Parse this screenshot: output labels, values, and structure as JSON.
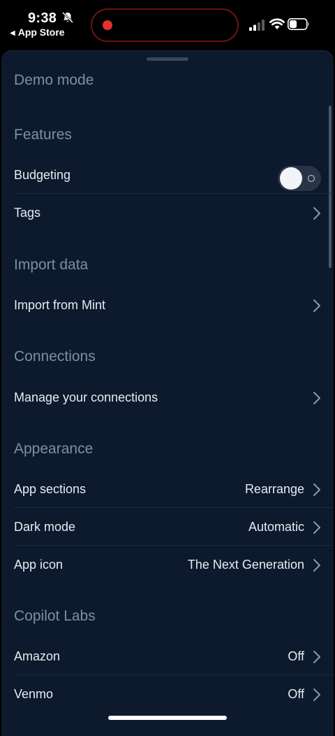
{
  "status_bar": {
    "time": "9:38",
    "back_label": "App Store",
    "icons": [
      "bell-off-icon",
      "recording-icon",
      "signal-icon",
      "wifi-icon",
      "battery-icon"
    ]
  },
  "colors": {
    "background": "#0d1a2d",
    "section_title": "#7e8ea6",
    "text": "#e6ebf2",
    "recording": "#e5322d"
  },
  "sections": {
    "demo_mode": {
      "title": "Demo mode"
    },
    "features": {
      "title": "Features",
      "budgeting": {
        "label": "Budgeting",
        "toggle_on": false
      },
      "tags": {
        "label": "Tags"
      }
    },
    "import_data": {
      "title": "Import data",
      "import_mint": {
        "label": "Import from Mint"
      }
    },
    "connections": {
      "title": "Connections",
      "manage": {
        "label": "Manage your connections"
      }
    },
    "appearance": {
      "title": "Appearance",
      "app_sections": {
        "label": "App sections",
        "value": "Rearrange"
      },
      "dark_mode": {
        "label": "Dark mode",
        "value": "Automatic"
      },
      "app_icon": {
        "label": "App icon",
        "value": "The Next Generation"
      }
    },
    "copilot_labs": {
      "title": "Copilot Labs",
      "amazon": {
        "label": "Amazon",
        "value": "Off"
      },
      "venmo": {
        "label": "Venmo",
        "value": "Off"
      }
    }
  }
}
